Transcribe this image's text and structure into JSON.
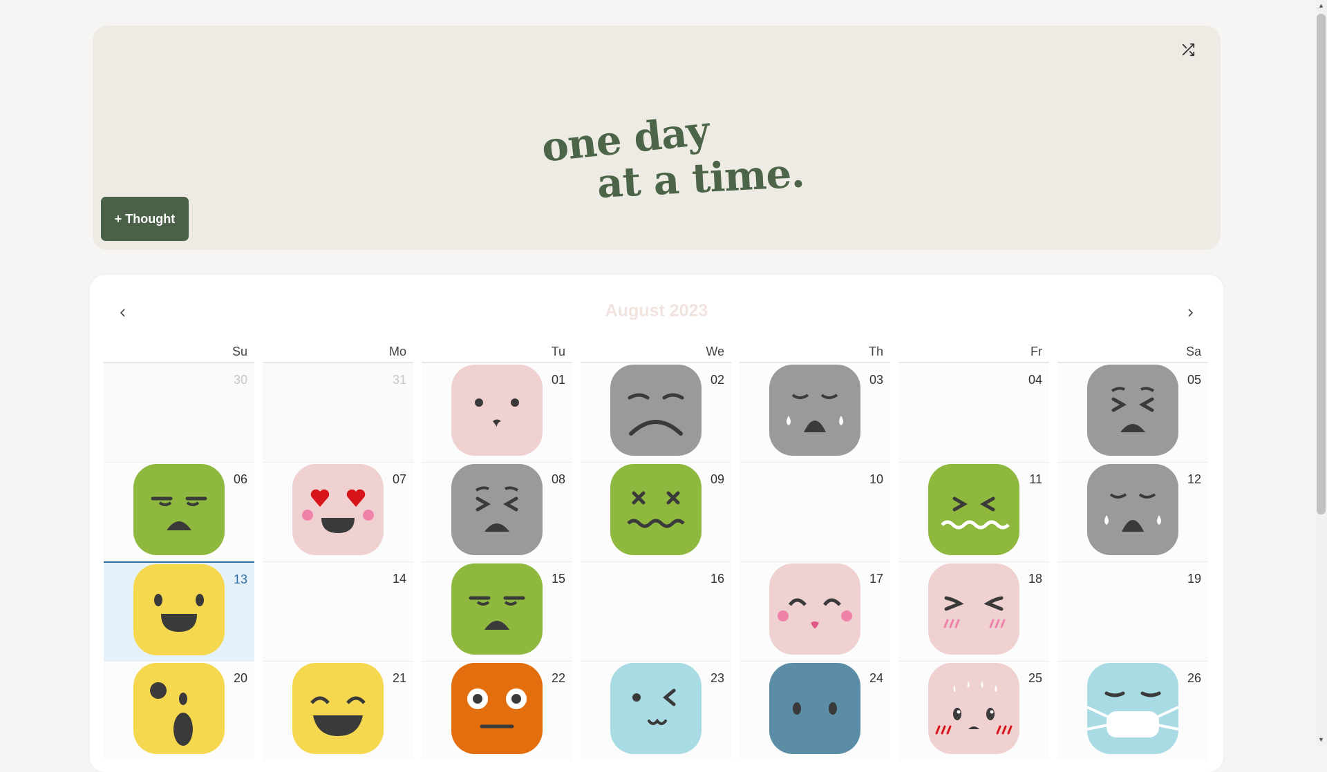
{
  "header": {
    "title_line1": "one day",
    "title_line2": "at a time.",
    "thought_button": "+ Thought",
    "shuffle_icon": "shuffle-icon"
  },
  "calendar": {
    "month": "August 2023",
    "weekdays": [
      "Su",
      "Mo",
      "Tu",
      "We",
      "Th",
      "Fr",
      "Sa"
    ],
    "weeks": [
      [
        {
          "num": "30",
          "other": true
        },
        {
          "num": "31",
          "other": true
        },
        {
          "num": "01",
          "mood": "pink-shy"
        },
        {
          "num": "02",
          "mood": "gray-frown"
        },
        {
          "num": "03",
          "mood": "gray-crying"
        },
        {
          "num": "04"
        },
        {
          "num": "05",
          "mood": "gray-squint"
        }
      ],
      [
        {
          "num": "06",
          "mood": "green-annoyed"
        },
        {
          "num": "07",
          "mood": "pink-heart-eyes"
        },
        {
          "num": "08",
          "mood": "gray-squint"
        },
        {
          "num": "09",
          "mood": "green-dizzy"
        },
        {
          "num": "10"
        },
        {
          "num": "11",
          "mood": "green-nauseous"
        },
        {
          "num": "12",
          "mood": "gray-crying"
        }
      ],
      [
        {
          "num": "13",
          "mood": "yellow-happy",
          "today": true
        },
        {
          "num": "14"
        },
        {
          "num": "15",
          "mood": "green-annoyed"
        },
        {
          "num": "16"
        },
        {
          "num": "17",
          "mood": "pink-content"
        },
        {
          "num": "18",
          "mood": "pink-giggle"
        },
        {
          "num": "19"
        }
      ],
      [
        {
          "num": "20",
          "mood": "yellow-surprised"
        },
        {
          "num": "21",
          "mood": "yellow-grin"
        },
        {
          "num": "22",
          "mood": "orange-neutral"
        },
        {
          "num": "23",
          "mood": "blue-wink"
        },
        {
          "num": "24",
          "mood": "teal-plain"
        },
        {
          "num": "25",
          "mood": "pink-nervous"
        },
        {
          "num": "26",
          "mood": "blue-mask"
        }
      ]
    ]
  },
  "colors": {
    "accent": "#4a6148",
    "hero_bg": "#eeebe5",
    "today": "#e5f1fb",
    "yellow": "#f5d84f",
    "green": "#8fb83e",
    "gray": "#9a9a9a",
    "pink": "#efd1d1",
    "orange": "#e36e0d",
    "light_blue": "#a8dbe3",
    "teal": "#5b8ea6"
  }
}
